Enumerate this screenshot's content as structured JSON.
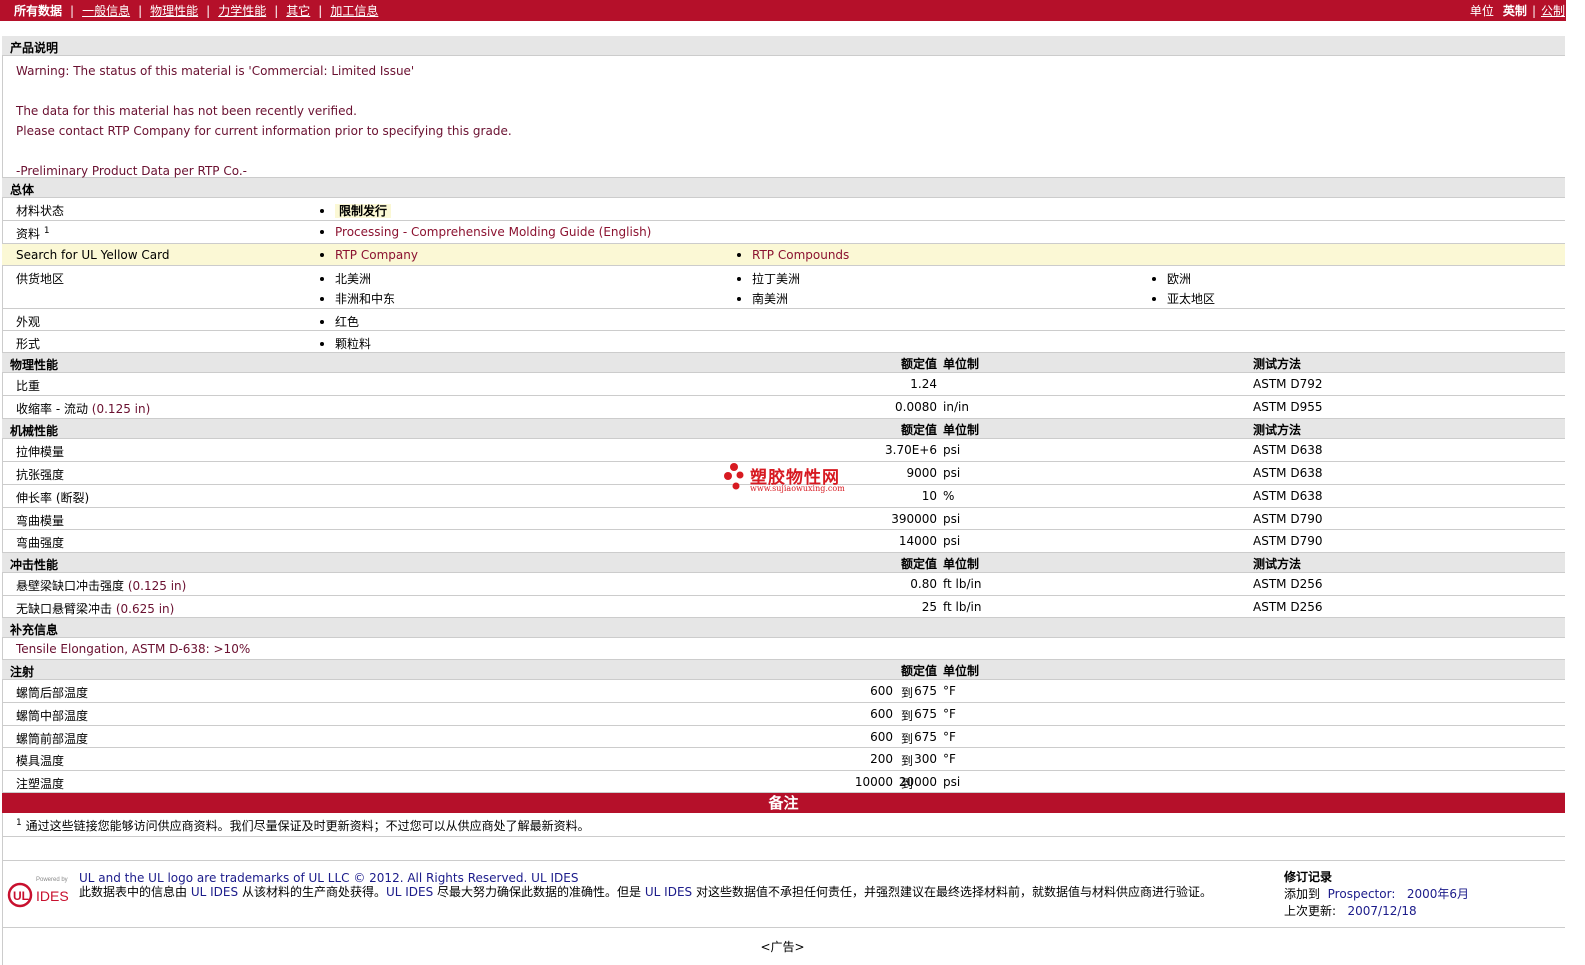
{
  "topbar": {
    "nav": [
      "所有数据",
      "一般信息",
      "物理性能",
      "力学性能",
      "其它",
      "加工信息"
    ],
    "units_label": "单位",
    "unit_active": "英制",
    "unit_alt": "公制"
  },
  "product_desc": {
    "title": "产品说明",
    "warning": "Warning: The status of this material is 'Commercial: Limited Issue'",
    "line2": "The data for this material has not been recently verified.",
    "line3": "Please contact RTP Company for current information prior to specifying this grade.",
    "line4": "-Preliminary Product Data per RTP Co.-"
  },
  "general": {
    "title": "总体",
    "status_label": "材料状态",
    "status_value": "限制发行",
    "docs_label": "资料",
    "docs_sup": "1",
    "docs_link": "Processing - Comprehensive Molding Guide (English)",
    "ul_label": "Search for UL Yellow Card",
    "ul_link1": "RTP Company",
    "ul_link2": "RTP Compounds",
    "region_label": "供货地区",
    "regions": [
      "北美洲",
      "拉丁美洲",
      "欧洲",
      "非洲和中东",
      "南美洲",
      "亚太地区"
    ],
    "appearance_label": "外观",
    "appearance_value": "红色",
    "form_label": "形式",
    "form_value": "颗粒料"
  },
  "col_headers": {
    "nominal": "额定值",
    "unit": "单位制",
    "test": "测试方法"
  },
  "physical": {
    "title": "物理性能",
    "rows": [
      {
        "label": "比重",
        "cond": "",
        "value": "1.24",
        "unit": "",
        "test": "ASTM D792"
      },
      {
        "label": "收缩率 - 流动",
        "cond": "(0.125 in)",
        "value": "0.0080",
        "unit": "in/in",
        "test": "ASTM D955"
      }
    ]
  },
  "mechanical": {
    "title": "机械性能",
    "rows": [
      {
        "label": "拉伸模量",
        "value": "3.70E+6",
        "unit": "psi",
        "test": "ASTM D638"
      },
      {
        "label": "抗张强度",
        "value": "9000",
        "unit": "psi",
        "test": "ASTM D638"
      },
      {
        "label": "伸长率 (断裂)",
        "value": "10",
        "unit": "%",
        "test": "ASTM D638"
      },
      {
        "label": "弯曲模量",
        "value": "390000",
        "unit": "psi",
        "test": "ASTM D790"
      },
      {
        "label": "弯曲强度",
        "value": "14000",
        "unit": "psi",
        "test": "ASTM D790"
      }
    ]
  },
  "impact": {
    "title": "冲击性能",
    "rows": [
      {
        "label": "悬壁梁缺口冲击强度",
        "cond": "(0.125 in)",
        "value": "0.80",
        "unit": "ft lb/in",
        "test": "ASTM D256"
      },
      {
        "label": "无缺口悬臂梁冲击",
        "cond": "(0.625 in)",
        "value": "25",
        "unit": "ft lb/in",
        "test": "ASTM D256"
      }
    ]
  },
  "supplement": {
    "title": "补充信息",
    "text": "Tensile Elongation, ASTM D-638: >10%"
  },
  "injection": {
    "title": "注射",
    "to": "到",
    "rows": [
      {
        "label": "螺筒后部温度",
        "v1": "600",
        "v2": "675",
        "unit": "°F"
      },
      {
        "label": "螺筒中部温度",
        "v1": "600",
        "v2": "675",
        "unit": "°F"
      },
      {
        "label": "螺筒前部温度",
        "v1": "600",
        "v2": "675",
        "unit": "°F"
      },
      {
        "label": "模具温度",
        "v1": "200",
        "v2": "300",
        "unit": "°F"
      },
      {
        "label": "注塑温度",
        "v1": "10000",
        "v2": "20000",
        "unit": "psi"
      }
    ]
  },
  "notes": {
    "title": "备注",
    "sup": "1",
    "text": "通过这些链接您能够访问供应商资料。我们尽量保证及时更新资料；不过您可以从供应商处了解最新资料。"
  },
  "footer": {
    "logo_powered": "Powered by",
    "logo_ul": "UL",
    "logo_ides": "IDES",
    "line1": "UL and the UL logo are trademarks of UL LLC © 2012. All Rights Reserved. UL IDES",
    "line2a": "此数据表中的信息由",
    "line2b": "UL IDES",
    "line2c": "从该材料的生产商处获得。",
    "line2d": "UL IDES",
    "line2e": "尽最大努力确保此数据的准确性。但是",
    "line2f": "UL IDES",
    "line2g": "对这些数据值不承担任何责任，并强烈建议在最终选择材料前，就数据值与材料供应商进行验证。",
    "rev_title": "修订记录",
    "rev_added_label": "添加到",
    "rev_added_where": "Prospector:",
    "rev_added_date": "2000年6月",
    "rev_updated_label": "上次更新:",
    "rev_updated_date": "2007/12/18"
  },
  "watermark": {
    "text": "塑胶物性网",
    "url": "www.sujiaowuxing.com"
  },
  "ad": "<广告>"
}
